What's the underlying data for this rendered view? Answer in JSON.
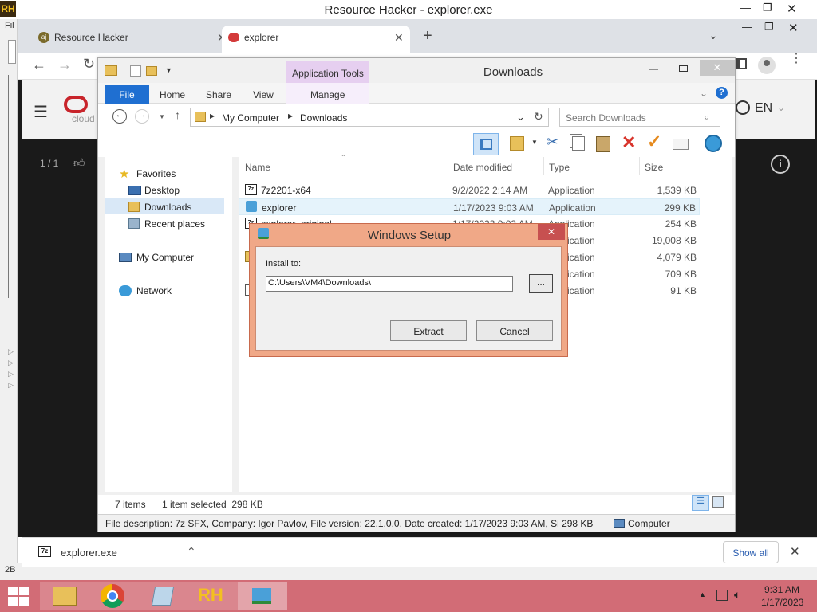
{
  "resource_hacker": {
    "title": "Resource Hacker - explorer.exe",
    "logo": "RH",
    "menu_fragment": "Fil",
    "status_fragment": "2B"
  },
  "browser": {
    "tabs": [
      {
        "label": "Resource Hacker"
      },
      {
        "label": "explorer"
      }
    ],
    "new_tab_label": "+",
    "site_logo_text": "cloud",
    "language": "EN",
    "page_counter": "1 / 1",
    "download": {
      "filename": "explorer.exe",
      "show_all_label": "Show all"
    }
  },
  "explorer": {
    "title": "Downloads",
    "context_tab": "Application Tools",
    "ribbon_tabs": [
      "File",
      "Home",
      "Share",
      "View",
      "Manage"
    ],
    "breadcrumb": [
      "My Computer",
      "Downloads"
    ],
    "search_placeholder": "Search Downloads",
    "nav": {
      "favorites": "Favorites",
      "favorites_items": [
        "Desktop",
        "Downloads",
        "Recent places"
      ],
      "my_computer": "My Computer",
      "network": "Network"
    },
    "columns": [
      "Name",
      "Date modified",
      "Type",
      "Size"
    ],
    "files": [
      {
        "name": "7z2201-x64",
        "date": "9/2/2022 2:14 AM",
        "type": "Application",
        "size": "1,539 KB"
      },
      {
        "name": "explorer",
        "date": "1/17/2023 9:03 AM",
        "type": "Application",
        "size": "299 KB"
      },
      {
        "name": "explorer_original",
        "date": "1/17/2023 9:03 AM",
        "type": "Application",
        "size": "254 KB"
      },
      {
        "name": "",
        "date": "",
        "type": "Application",
        "size": "19,008 KB"
      },
      {
        "name": "",
        "date": "",
        "type": "Application",
        "size": "4,079 KB"
      },
      {
        "name": "",
        "date": "",
        "type": "Application",
        "size": "709 KB"
      },
      {
        "name": "",
        "date": "",
        "type": "Application",
        "size": "91 KB"
      }
    ],
    "status": {
      "items": "7 items",
      "selected": "1 item selected  298 KB"
    },
    "details": "File description: 7z SFX, Company: Igor Pavlov, File version: 22.1.0.0, Date created: 1/17/2023 9:03 AM, Si 298 KB",
    "details_location": "Computer"
  },
  "setup_dialog": {
    "title": "Windows Setup",
    "install_label": "Install to:",
    "path_value": "C:\\Users\\VM4\\Downloads\\",
    "browse_label": "...",
    "extract_label": "Extract",
    "cancel_label": "Cancel"
  },
  "taskbar": {
    "time": "9:31 AM",
    "date": "1/17/2023",
    "rh_label": "RH"
  },
  "colors": {
    "taskbar": "#d26c76",
    "dialog_frame": "#f0a887",
    "file_tab": "#1f6fd1",
    "context_tab": "#e6cff0"
  }
}
